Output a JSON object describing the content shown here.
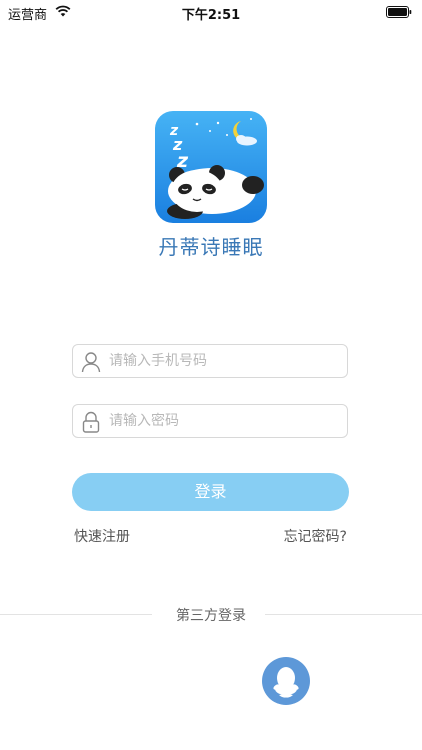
{
  "status_bar": {
    "carrier": "运营商",
    "time": "下午2:51"
  },
  "app": {
    "name": "丹蒂诗睡眠",
    "logo_text": "Z z z"
  },
  "form": {
    "phone_placeholder": "请输入手机号码",
    "password_placeholder": "请输入密码",
    "login_label": "登录",
    "register_label": "快速注册",
    "forgot_label": "忘记密码?"
  },
  "third_party": {
    "label": "第三方登录",
    "providers": [
      "qq"
    ]
  },
  "colors": {
    "accent": "#87cef3",
    "app_name": "#3a78b6",
    "logo_bg": "#1a8fe6",
    "qq": "#5d98d8"
  }
}
